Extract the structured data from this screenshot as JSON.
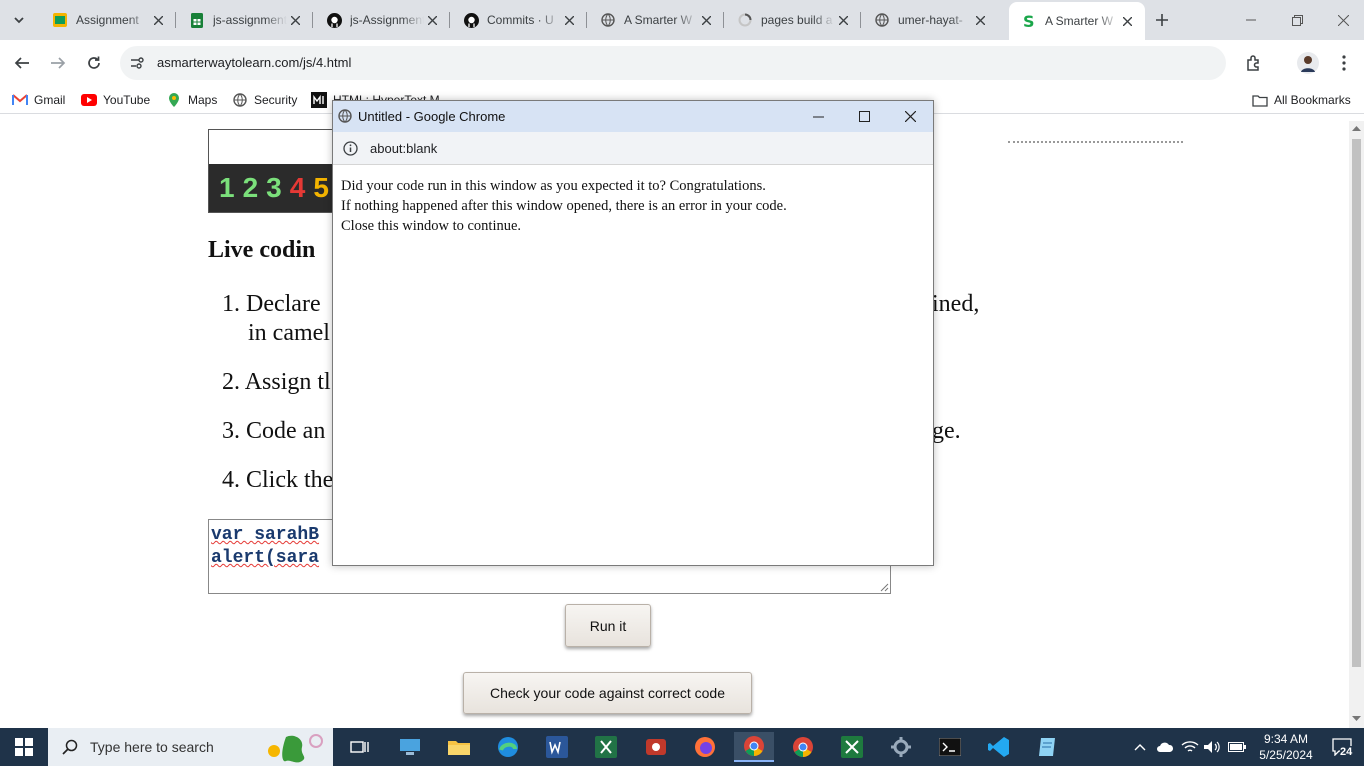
{
  "tabs": [
    {
      "title": "Assignment",
      "icon": "google-classroom-icon",
      "color": "#f4b400"
    },
    {
      "title": "js-assignment",
      "icon": "google-sheets-icon",
      "color": "#188038"
    },
    {
      "title": "js-Assignment",
      "icon": "github-icon",
      "color": "#111"
    },
    {
      "title": "Commits · U",
      "icon": "github-icon",
      "color": "#111"
    },
    {
      "title": "A Smarter W",
      "icon": "globe-icon",
      "color": "#555"
    },
    {
      "title": "pages build a",
      "icon": "loading-icon",
      "color": "#555"
    },
    {
      "title": "umer-hayat-",
      "icon": "globe-icon",
      "color": "#555"
    },
    {
      "title": "A Smarter W",
      "icon": "smarter-way-icon",
      "color": "#1aa64a"
    }
  ],
  "address": {
    "url": "asmarterwaytolearn.com/js/4.html"
  },
  "bookmarks": [
    {
      "label": "Gmail",
      "icon": "gmail-icon"
    },
    {
      "label": "YouTube",
      "icon": "youtube-icon"
    },
    {
      "label": "Maps",
      "icon": "maps-icon"
    },
    {
      "label": "Security",
      "icon": "globe-icon"
    },
    {
      "label": "HTML: HyperText M",
      "icon": "mdn-icon"
    }
  ],
  "all_bookmarks": "All Bookmarks",
  "page": {
    "banner_numbers": [
      "1",
      "2",
      "3",
      "4",
      "5"
    ],
    "heading": "Live codin",
    "steps": [
      {
        "num": "1.",
        "text": "Declare",
        "tail": "ined,"
      },
      {
        "num": "",
        "text": "in camel",
        "tail": ""
      },
      {
        "num": "2.",
        "text": "Assign tl",
        "tail": ""
      },
      {
        "num": "3.",
        "text": "Code an",
        "tail": "ge."
      },
      {
        "num": "4.",
        "text": "Click the",
        "tail": ""
      }
    ],
    "code_lines": [
      "var sarahB",
      "alert(sara"
    ],
    "run_button": "Run it",
    "check_button": "Check your code against correct code"
  },
  "popup": {
    "title": "Untitled - Google Chrome",
    "url": "about:blank",
    "lines": [
      "Did your code run in this window as you expected it to? Congratulations.",
      "If nothing happened after this window opened, there is an error in your code.",
      "Close this window to continue."
    ]
  },
  "taskbar": {
    "search_placeholder": "Type here to search",
    "time": "9:34 AM",
    "date": "5/25/2024",
    "notifications": "24"
  }
}
